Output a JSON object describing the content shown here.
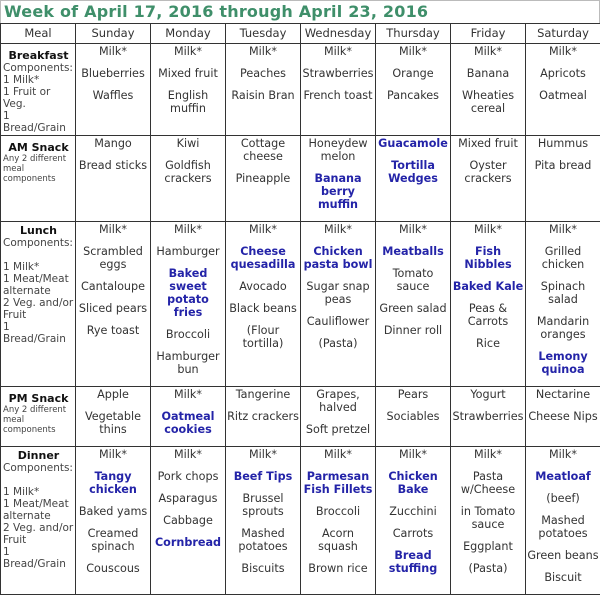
{
  "title": "Week of April 17, 2016 through April 23, 2016",
  "colors": {
    "title": "#3f8f6a",
    "highlight": "#2424a8",
    "text": "#333333",
    "border": "#333333"
  },
  "header": {
    "meal": "Meal",
    "days": [
      "Sunday",
      "Monday",
      "Tuesday",
      "Wednesday",
      "Thursday",
      "Friday",
      "Saturday"
    ]
  },
  "meals": [
    {
      "name": "Breakfast",
      "components": "Components:\n1 Milk*\n1 Fruit or Veg.\n1 Bread/Grain",
      "days": [
        [
          {
            "t": "Milk*"
          },
          {
            "t": "Blueberries"
          },
          {
            "t": "Waffles"
          }
        ],
        [
          {
            "t": "Milk*"
          },
          {
            "t": "Mixed fruit"
          },
          {
            "t": "English muffin"
          }
        ],
        [
          {
            "t": "Milk*"
          },
          {
            "t": "Peaches"
          },
          {
            "t": "Raisin Bran"
          }
        ],
        [
          {
            "t": "Milk*"
          },
          {
            "t": "Strawberries"
          },
          {
            "t": "French toast"
          }
        ],
        [
          {
            "t": "Milk*"
          },
          {
            "t": "Orange"
          },
          {
            "t": "Pancakes"
          }
        ],
        [
          {
            "t": "Milk*"
          },
          {
            "t": "Banana"
          },
          {
            "t": "Wheaties cereal"
          }
        ],
        [
          {
            "t": "Milk*"
          },
          {
            "t": "Apricots"
          },
          {
            "t": "Oatmeal"
          }
        ]
      ]
    },
    {
      "name": "AM Snack",
      "components": "Any 2 different meal components",
      "days": [
        [
          {
            "t": "Mango"
          },
          {
            "t": "Bread sticks"
          }
        ],
        [
          {
            "t": "Kiwi"
          },
          {
            "t": "Goldfish crackers"
          }
        ],
        [
          {
            "t": "Cottage cheese"
          },
          {
            "t": "Pineapple"
          }
        ],
        [
          {
            "t": "Honeydew melon"
          },
          {
            "t": "Banana berry muffin",
            "hl": true
          }
        ],
        [
          {
            "t": "Guacamole",
            "hl": true
          },
          {
            "t": "Tortilla Wedges",
            "hl": true
          }
        ],
        [
          {
            "t": "Mixed fruit"
          },
          {
            "t": "Oyster crackers"
          }
        ],
        [
          {
            "t": "Hummus"
          },
          {
            "t": "Pita bread"
          }
        ]
      ]
    },
    {
      "name": "Lunch",
      "components": "Components:\n\n1 Milk*\n1 Meat/Meat\n   alternate\n2 Veg. and/or\n   Fruit\n1 Bread/Grain",
      "days": [
        [
          {
            "t": "Milk*"
          },
          {
            "t": "Scrambled eggs"
          },
          {
            "t": "Cantaloupe"
          },
          {
            "t": "Sliced pears"
          },
          {
            "t": "Rye toast"
          }
        ],
        [
          {
            "t": "Milk*"
          },
          {
            "t": "Hamburger"
          },
          {
            "t": "Baked sweet potato fries",
            "hl": true
          },
          {
            "t": "Broccoli"
          },
          {
            "t": "Hamburger bun"
          }
        ],
        [
          {
            "t": "Milk*"
          },
          {
            "t": "Cheese quesadilla",
            "hl": true
          },
          {
            "t": "Avocado"
          },
          {
            "t": "Black beans"
          },
          {
            "t": "(Flour tortilla)"
          }
        ],
        [
          {
            "t": "Milk*"
          },
          {
            "t": "Chicken pasta bowl",
            "hl": true
          },
          {
            "t": "Sugar snap peas"
          },
          {
            "t": "Cauliflower"
          },
          {
            "t": "(Pasta)"
          }
        ],
        [
          {
            "t": "Milk*"
          },
          {
            "t": "Meatballs",
            "hl": true
          },
          {
            "t": "Tomato sauce"
          },
          {
            "t": "Green salad"
          },
          {
            "t": "Dinner roll"
          }
        ],
        [
          {
            "t": "Milk*"
          },
          {
            "t": "Fish Nibbles",
            "hl": true
          },
          {
            "t": "Baked Kale",
            "hl": true
          },
          {
            "t": "Peas & Carrots"
          },
          {
            "t": "Rice"
          }
        ],
        [
          {
            "t": "Milk*"
          },
          {
            "t": "Grilled chicken"
          },
          {
            "t": "Spinach salad"
          },
          {
            "t": "Mandarin oranges"
          },
          {
            "t": "Lemony quinoa",
            "hl": true
          }
        ]
      ]
    },
    {
      "name": "PM Snack",
      "components": "Any 2 different meal components",
      "days": [
        [
          {
            "t": "Apple"
          },
          {
            "t": "Vegetable thins"
          }
        ],
        [
          {
            "t": "Milk*"
          },
          {
            "t": "Oatmeal cookies",
            "hl": true
          }
        ],
        [
          {
            "t": "Tangerine"
          },
          {
            "t": "Ritz crackers"
          }
        ],
        [
          {
            "t": "Grapes, halved"
          },
          {
            "t": "Soft pretzel"
          }
        ],
        [
          {
            "t": "Pears"
          },
          {
            "t": "Sociables"
          }
        ],
        [
          {
            "t": "Yogurt"
          },
          {
            "t": "Strawberries"
          }
        ],
        [
          {
            "t": "Nectarine"
          },
          {
            "t": "Cheese Nips"
          }
        ]
      ]
    },
    {
      "name": "Dinner",
      "components": "Components:\n\n1 Milk*\n1 Meat/Meat\n   alternate\n2 Veg. and/or\n   Fruit\n1 Bread/Grain",
      "days": [
        [
          {
            "t": "Milk*"
          },
          {
            "t": "Tangy chicken",
            "hl": true
          },
          {
            "t": "Baked yams"
          },
          {
            "t": "Creamed spinach"
          },
          {
            "t": "Couscous"
          }
        ],
        [
          {
            "t": "Milk*"
          },
          {
            "t": "Pork chops"
          },
          {
            "t": "Asparagus"
          },
          {
            "t": "Cabbage"
          },
          {
            "t": "Cornbread",
            "hl": true
          }
        ],
        [
          {
            "t": "Milk*"
          },
          {
            "t": "Beef Tips",
            "hl": true
          },
          {
            "t": "Brussel sprouts"
          },
          {
            "t": "Mashed potatoes"
          },
          {
            "t": "Biscuits"
          }
        ],
        [
          {
            "t": "Milk*"
          },
          {
            "t": "Parmesan Fish Fillets",
            "hl": true
          },
          {
            "t": "Broccoli"
          },
          {
            "t": "Acorn squash"
          },
          {
            "t": "Brown rice"
          }
        ],
        [
          {
            "t": "Milk*"
          },
          {
            "t": "Chicken Bake",
            "hl": true
          },
          {
            "t": "Zucchini"
          },
          {
            "t": "Carrots"
          },
          {
            "t": "Bread stuffing",
            "hl": true
          }
        ],
        [
          {
            "t": "Milk*"
          },
          {
            "t": "Pasta w/Cheese"
          },
          {
            "t": "in Tomato sauce"
          },
          {
            "t": "Eggplant"
          },
          {
            "t": "(Pasta)"
          }
        ],
        [
          {
            "t": "Milk*"
          },
          {
            "t": "Meatloaf",
            "hl": true
          },
          {
            "t": "(beef)"
          },
          {
            "t": "Mashed potatoes"
          },
          {
            "t": "Green beans"
          },
          {
            "t": "Biscuit"
          }
        ]
      ]
    }
  ]
}
